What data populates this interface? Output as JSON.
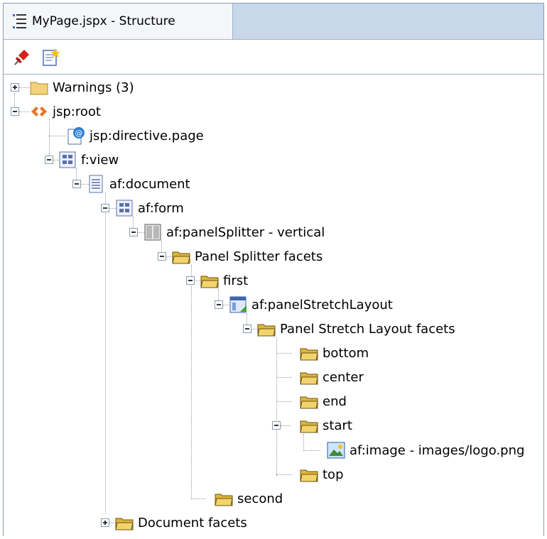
{
  "tab": {
    "title": "MyPage.jspx - Structure",
    "icon": "structure-icon"
  },
  "toolbar": {
    "buttons": [
      {
        "icon": "pin-icon"
      },
      {
        "icon": "edit-properties-icon"
      }
    ]
  },
  "tree": {
    "warnings": "Warnings (3)",
    "jsp_root": "jsp:root",
    "jsp_directive_page": "jsp:directive.page",
    "f_view": "f:view",
    "af_document": "af:document",
    "af_form": "af:form",
    "af_panelSplitter": "af:panelSplitter - vertical",
    "panel_splitter_facets": "Panel Splitter facets",
    "first": "first",
    "af_panelStretchLayout": "af:panelStretchLayout",
    "panel_stretch_layout_facets": "Panel Stretch Layout facets",
    "bottom": "bottom",
    "center": "center",
    "end": "end",
    "start": "start",
    "af_image": "af:image - images/logo.png",
    "top": "top",
    "second": "second",
    "document_facets": "Document facets"
  },
  "colors": {
    "tab_bar": "#c8d7ea",
    "folder": "#f2d27a",
    "facet_folder": "#e0b43a",
    "jsp_root_icon": "#e8742a",
    "border": "#8a9cb3"
  }
}
